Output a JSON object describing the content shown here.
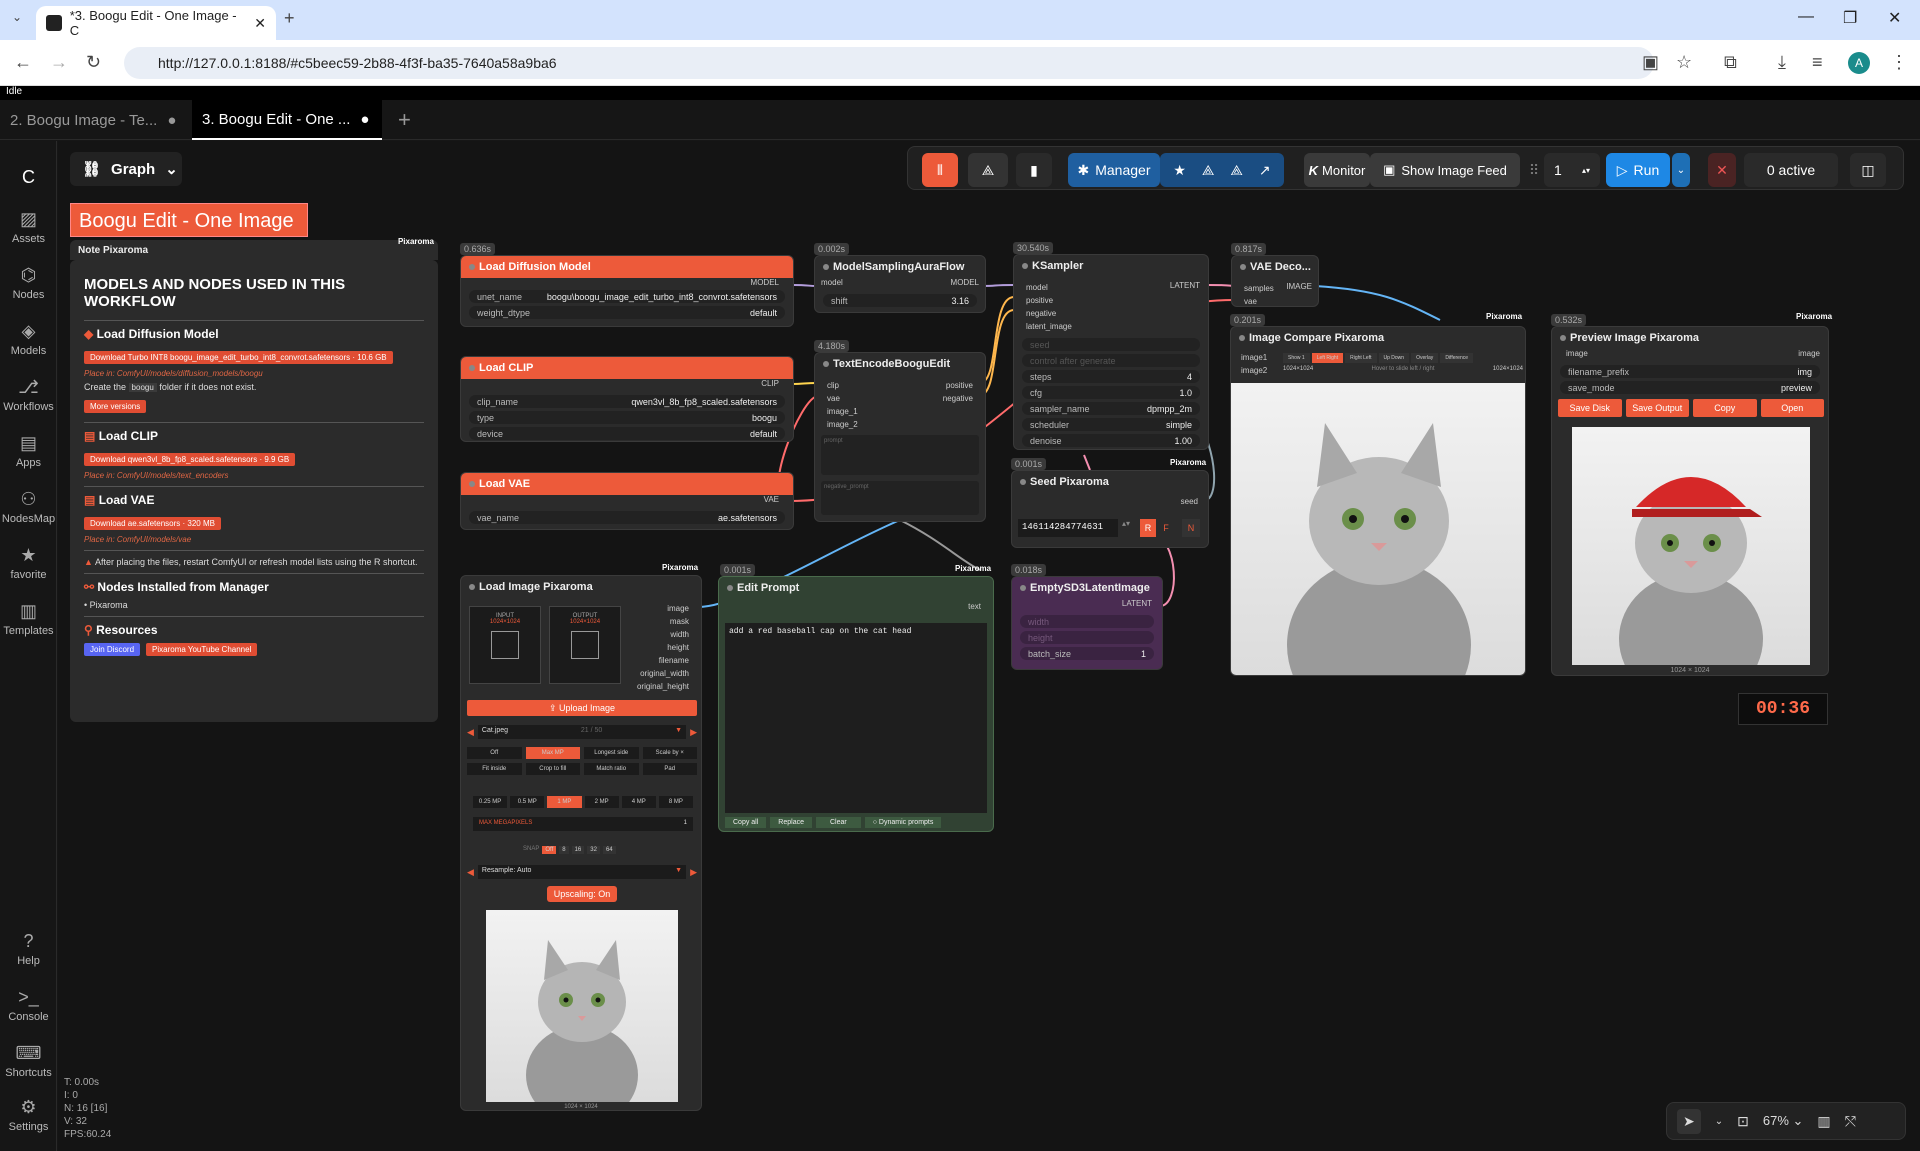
{
  "browser": {
    "tab_title": "*3. Boogu Edit - One Image - C",
    "url": "http://127.0.0.1:8188/#c5beec59-2b88-4f3f-ba35-7640a58a9ba6",
    "profile": "A"
  },
  "status": "Idle",
  "workflow_tabs": [
    "2. Boogu Image - Te...",
    "3. Boogu Edit - One ..."
  ],
  "graph_label": "Graph",
  "sidebar": [
    "Assets",
    "Nodes",
    "Models",
    "Workflows",
    "Apps",
    "NodesMap",
    "favorite",
    "Templates",
    "Help",
    "Console",
    "Shortcuts",
    "Settings"
  ],
  "toolbar": {
    "manager": "Manager",
    "monitor": "Monitor",
    "feed": "Show Image Feed",
    "queue": "1",
    "run": "Run",
    "active": "0 active"
  },
  "title": "Boogu Edit - One Image",
  "note": {
    "header": "Note Pixaroma",
    "tag": "Pixaroma",
    "heading": "MODELS AND NODES USED IN THIS WORKFLOW",
    "s1": "Load Diffusion Model",
    "b1": "Download Turbo INT8 boogu_image_edit_turbo_int8_convrot.safetensors · 10.6 GB",
    "p1": "Place in: ComfyUI/models/diffusion_models/boogu",
    "create": "Create the",
    "boogu": "boogu",
    "create2": "folder if it does not exist.",
    "more": "More versions",
    "s2": "Load CLIP",
    "b2": "Download qwen3vl_8b_fp8_scaled.safetensors · 9.9 GB",
    "p2": "Place in: ComfyUI/models/text_encoders",
    "s3": "Load VAE",
    "b3": "Download ae.safetensors · 320 MB",
    "p3": "Place in: ComfyUI/models/vae",
    "warn": "After placing the files, restart ComfyUI or refresh model lists using the R shortcut.",
    "s4": "Nodes Installed from Manager",
    "li": "Pixaroma",
    "s5": "Resources",
    "discord": "Join Discord",
    "yt": "Pixaroma YouTube Channel"
  },
  "nodes": {
    "ldm": {
      "title": "Load Diffusion Model",
      "time": "0.636s",
      "unet": "unet_name",
      "unet_v": "boogu\\boogu_image_edit_turbo_int8_convrot.safetensors",
      "wd": "weight_dtype",
      "wd_v": "default",
      "out": "MODEL"
    },
    "clip": {
      "title": "Load CLIP",
      "name": "clip_name",
      "name_v": "qwen3vl_8b_fp8_scaled.safetensors",
      "type": "type",
      "type_v": "boogu",
      "dev": "device",
      "dev_v": "default",
      "out": "CLIP"
    },
    "vae": {
      "title": "Load VAE",
      "name": "vae_name",
      "name_v": "ae.safetensors",
      "out": "VAE"
    },
    "msaf": {
      "title": "ModelSamplingAuraFlow",
      "time": "0.002s",
      "in": "model",
      "out": "MODEL",
      "shift": "shift",
      "shift_v": "3.16"
    },
    "teb": {
      "title": "TextEncodeBooguEdit",
      "time": "4.180s",
      "i1": "clip",
      "i2": "vae",
      "i3": "image_1",
      "i4": "image_2",
      "i5": "prompt",
      "o1": "positive",
      "o2": "negative",
      "neg": "negative_prompt"
    },
    "ks": {
      "title": "KSampler",
      "time": "30.540s",
      "i1": "model",
      "i2": "positive",
      "i3": "negative",
      "i4": "latent_image",
      "seed": "seed",
      "cag": "control after generate",
      "steps": "steps",
      "steps_v": "4",
      "cfg": "cfg",
      "cfg_v": "1.0",
      "sampler": "sampler_name",
      "sampler_v": "dpmpp_2m",
      "sched": "scheduler",
      "sched_v": "simple",
      "den": "denoise",
      "den_v": "1.00",
      "out": "LATENT"
    },
    "vaed": {
      "title": "VAE Deco...",
      "time": "0.817s",
      "i1": "samples",
      "i2": "vae",
      "out": "IMAGE"
    },
    "seed": {
      "title": "Seed Pixaroma",
      "time": "0.001s",
      "out": "seed",
      "val": "1461142847746​31",
      "r": "R",
      "f": "F",
      "n": "N",
      "tag": "Pixaroma"
    },
    "lip": {
      "title": "Load Image Pixaroma",
      "tag": "Pixaroma",
      "o1": "image",
      "o2": "mask",
      "o3": "width",
      "o4": "height",
      "o5": "filename",
      "o6": "original_width",
      "o7": "original_height",
      "inp": "INPUT",
      "inpv": "1024×1024",
      "outp": "OUTPUT",
      "outpv": "1024×1024",
      "upload": "Upload Image",
      "file": "Cat.jpeg",
      "count": "21 / 50",
      "modes": [
        "Off",
        "Max MP",
        "Longest side",
        "Scale by ×",
        "Fit inside",
        "Crop to fill",
        "Match ratio",
        "Pad"
      ],
      "mps": [
        "0.25 MP",
        "0.5 MP",
        "1 MP",
        "2 MP",
        "4 MP",
        "8 MP"
      ],
      "maxmp": "MAX MEGAPIXELS",
      "maxmpv": "1",
      "snap": "SNAP",
      "snaps": [
        "Off",
        "8",
        "16",
        "32",
        "64"
      ],
      "resample": "Resample: Auto",
      "upscale": "Upscaling: On",
      "size": "1024 × 1024"
    },
    "ep": {
      "title": "Edit Prompt",
      "time": "0.001s",
      "tag": "Pixaroma",
      "out": "text",
      "prompt": "add a red baseball cap on the cat head",
      "b1": "Copy all",
      "b2": "Replace",
      "b3": "Clear",
      "b4": "Dynamic prompts"
    },
    "esd": {
      "title": "EmptySD3LatentImage",
      "time": "0.018s",
      "out": "LATENT",
      "w": "width",
      "h": "height",
      "bs": "batch_size",
      "bsv": "1"
    },
    "icp": {
      "title": "Image Compare Pixaroma",
      "time": "0.201s",
      "tag": "Pixaroma",
      "i1": "image1",
      "i2": "image2",
      "tabs": [
        "Show 1",
        "Left Right",
        "Right Left",
        "Up Down",
        "Overlay",
        "Difference"
      ],
      "s1": "1024×1024",
      "hint": "Hover to slide left / right",
      "s2": "1024×1024"
    },
    "pip": {
      "title": "Preview Image Pixaroma",
      "time": "0.532s",
      "tag": "Pixaroma",
      "i1": "image",
      "o1": "image",
      "fp": "filename_prefix",
      "fpv": "img",
      "sm": "save_mode",
      "smv": "preview",
      "b1": "Save Disk",
      "b2": "Save Output",
      "b3": "Copy",
      "b4": "Open",
      "size": "1024 × 1024"
    }
  },
  "timer": "00:36",
  "stats": [
    "T: 0.00s",
    "I: 0",
    "N: 16 [16]",
    "V: 32",
    "FPS:60.24"
  ],
  "zoom": "67%"
}
